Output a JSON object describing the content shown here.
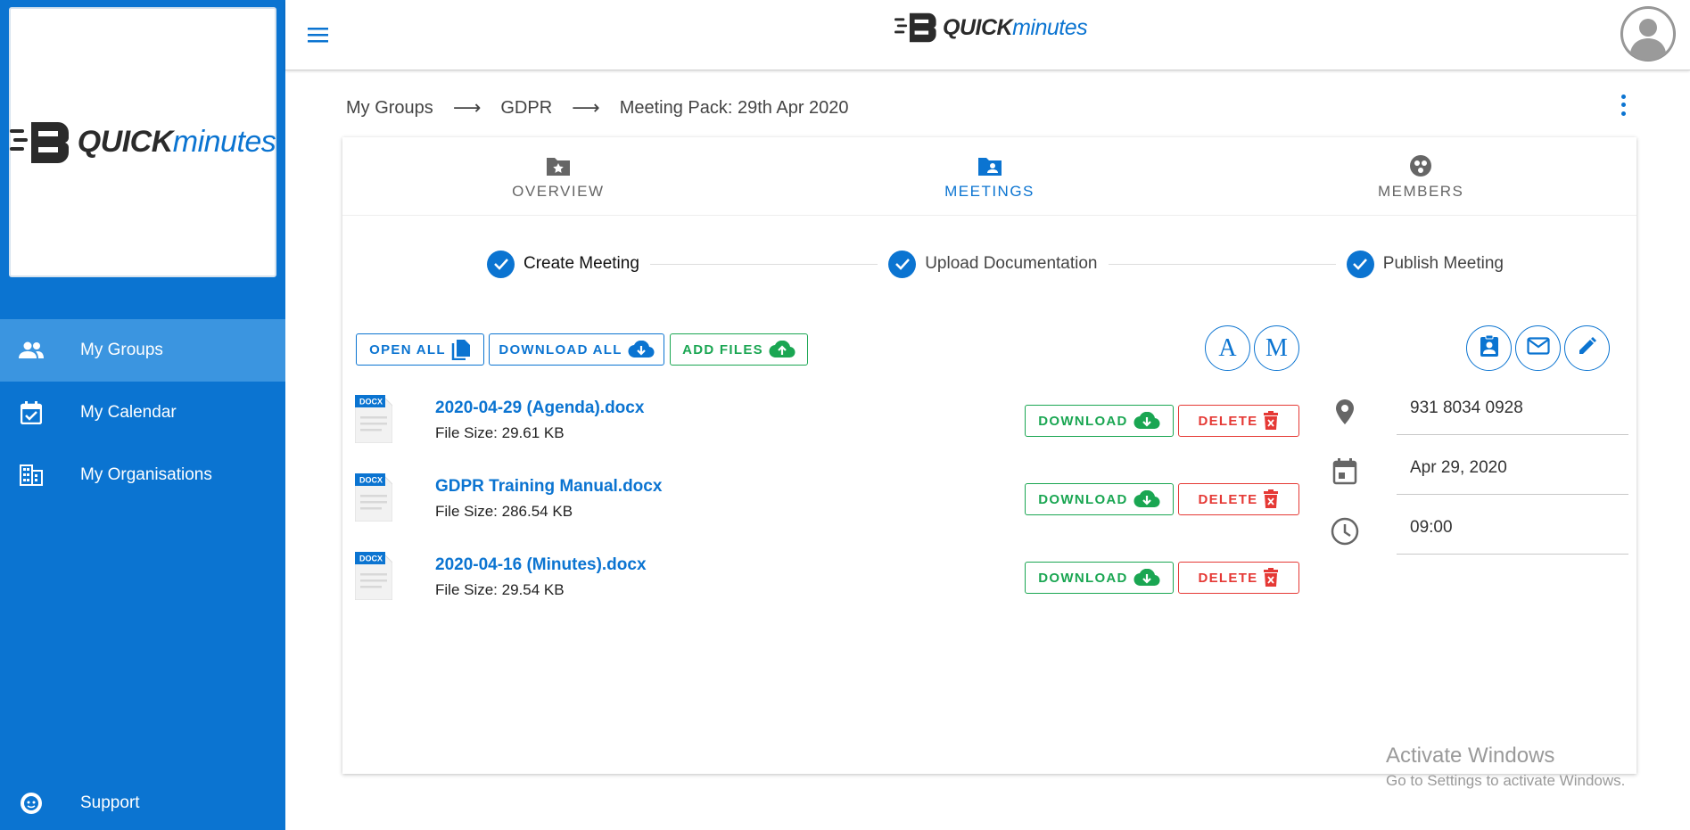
{
  "brand": {
    "logo_quick": "QUICK",
    "logo_minutes": "minutes",
    "primary_color": "#0b74d1",
    "success_color": "#1aa652",
    "danger_color": "#e53935"
  },
  "sidebar": {
    "items": [
      {
        "label": "My Groups",
        "icon": "people-icon",
        "active": true
      },
      {
        "label": "My Calendar",
        "icon": "calendar-check-icon",
        "active": false
      },
      {
        "label": "My Organisations",
        "icon": "building-icon",
        "active": false
      }
    ],
    "support": {
      "label": "Support",
      "icon": "support-icon"
    }
  },
  "header": {
    "menu_icon": "hamburger-icon",
    "avatar_icon": "user-avatar-icon"
  },
  "breadcrumb": [
    "My Groups",
    "GDPR",
    "Meeting Pack: 29th Apr 2020"
  ],
  "tabs": [
    {
      "label": "OVERVIEW",
      "icon": "folder-star-icon",
      "active": false
    },
    {
      "label": "MEETINGS",
      "icon": "folder-user-icon",
      "active": true
    },
    {
      "label": "MEMBERS",
      "icon": "group-circle-icon",
      "active": false
    }
  ],
  "stepper": [
    {
      "label": "Create Meeting",
      "done": true
    },
    {
      "label": "Upload Documentation",
      "done": true
    },
    {
      "label": "Publish Meeting",
      "done": true
    }
  ],
  "actions": {
    "open_all": "OPEN ALL",
    "download_all": "DOWNLOAD ALL",
    "add_files": "ADD FILES",
    "agenda_letter": "A",
    "minutes_letter": "M"
  },
  "files": [
    {
      "name": "2020-04-29 (Agenda).docx",
      "size": "File Size: 29.61 KB",
      "type": "DOCX"
    },
    {
      "name": "GDPR Training Manual.docx",
      "size": "File Size: 286.54 KB",
      "type": "DOCX"
    },
    {
      "name": "2020-04-16 (Minutes).docx",
      "size": "File Size: 29.54 KB",
      "type": "DOCX"
    }
  ],
  "file_actions": {
    "download": "DOWNLOAD",
    "delete": "DELETE"
  },
  "details": {
    "location": "931 8034 0928",
    "date": "Apr 29, 2020",
    "time": "09:00"
  },
  "watermark": {
    "line1": "Activate Windows",
    "line2": "Go to Settings to activate Windows."
  }
}
